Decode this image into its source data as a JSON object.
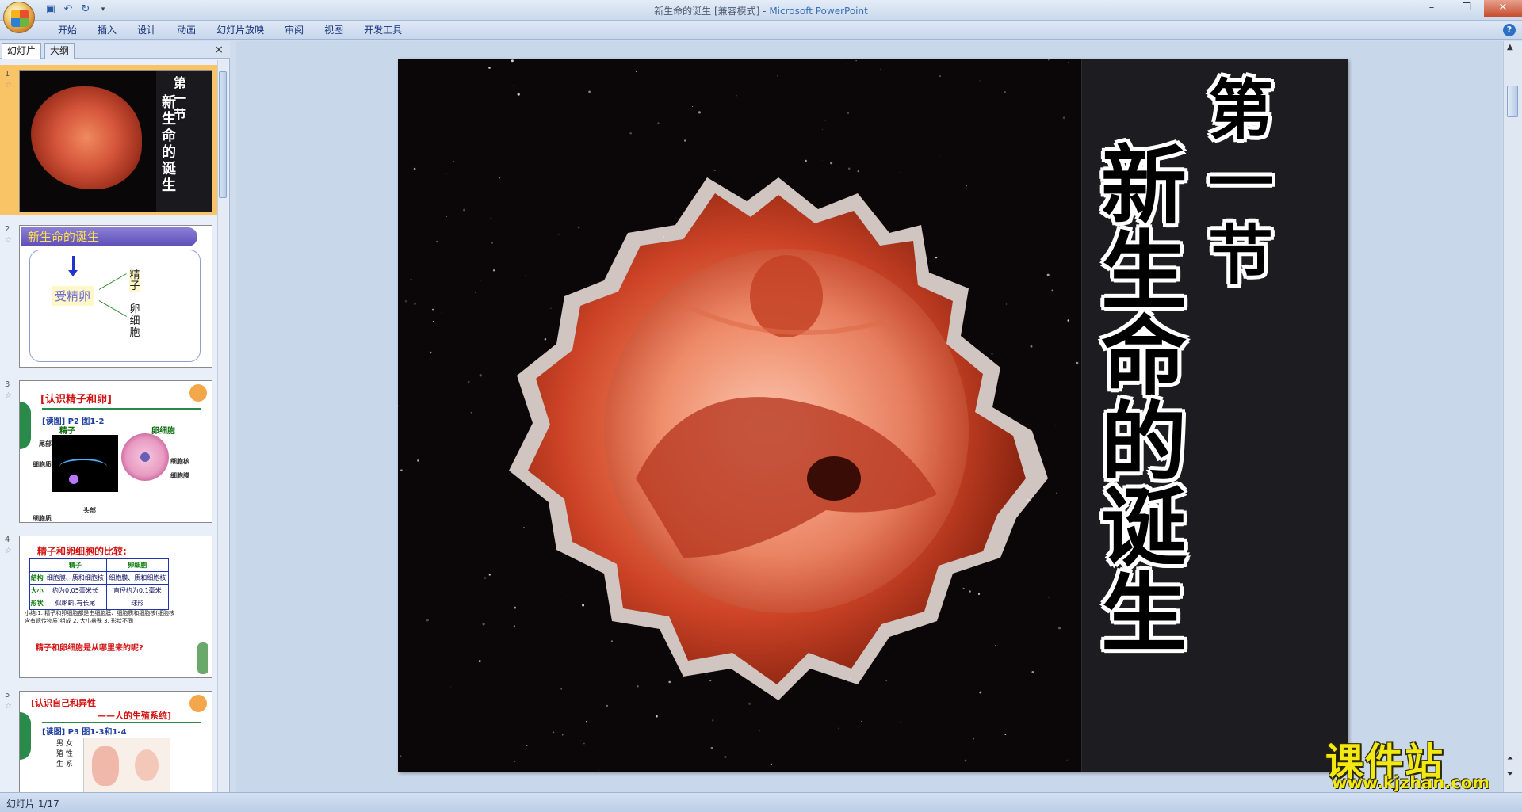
{
  "window": {
    "title_doc": "新生命的诞生 [兼容模式]",
    "title_sep": " - ",
    "title_app": "Microsoft PowerPoint"
  },
  "quick_access": [
    "save-icon",
    "undo-icon",
    "redo-icon",
    "customize-icon"
  ],
  "ribbon": {
    "tabs": [
      "开始",
      "插入",
      "设计",
      "动画",
      "幻灯片放映",
      "审阅",
      "视图",
      "开发工具"
    ]
  },
  "panel": {
    "tabs": [
      "幻灯片",
      "大纲"
    ],
    "close": "×"
  },
  "thumbnails": [
    {
      "num": "1",
      "title_small": "第一节",
      "title_big": "新生命的诞生"
    },
    {
      "num": "2",
      "header": "新生命的诞生",
      "center": "受精卵",
      "branch1": "精子",
      "branch2": "卵细胞"
    },
    {
      "num": "3",
      "title": "[认识精子和卵]",
      "sub": "[读图] P2 图1-2",
      "label_sperm": "精子",
      "label_egg": "卵细胞",
      "tail": "尾部",
      "head": "头部",
      "nucleus": "细胞核",
      "cell": "细胞膜",
      "cytoplasm": "细胞质",
      "membrane": "细胞质"
    },
    {
      "num": "4",
      "title": "精子和卵细胞的比较:",
      "table_head": [
        "",
        "精子",
        "卵细胞"
      ],
      "table_rows": [
        [
          "结构",
          "细胞膜、质和细胞核",
          "细胞膜、质和细胞核"
        ],
        [
          "大小",
          "约为0.05毫米长",
          "直径约为0.1毫米"
        ],
        [
          "形状",
          "似蝌蚪,有长尾",
          "球形"
        ]
      ],
      "notes": "小结:1. 精子和卵细胞都是由细胞膜、细胞质和细胞核(细胞核含有遗传物质)组成 2. 大小悬殊 3. 形状不同",
      "question": "精子和卵细胞是从哪里来的呢?"
    },
    {
      "num": "5",
      "title": "[认识自己和异性",
      "title2": "——人的生殖系统]",
      "sub": "[读图] P3 图1-3和1-4",
      "vert": "男 女 殖 性 生 系"
    }
  ],
  "slide": {
    "title_small": "第一节",
    "title_big": "新生命的诞生"
  },
  "watermark": {
    "cn": "课件站",
    "url": "www.kjzhan.com"
  },
  "status": {
    "slide_counter": "幻灯片 1/17"
  }
}
